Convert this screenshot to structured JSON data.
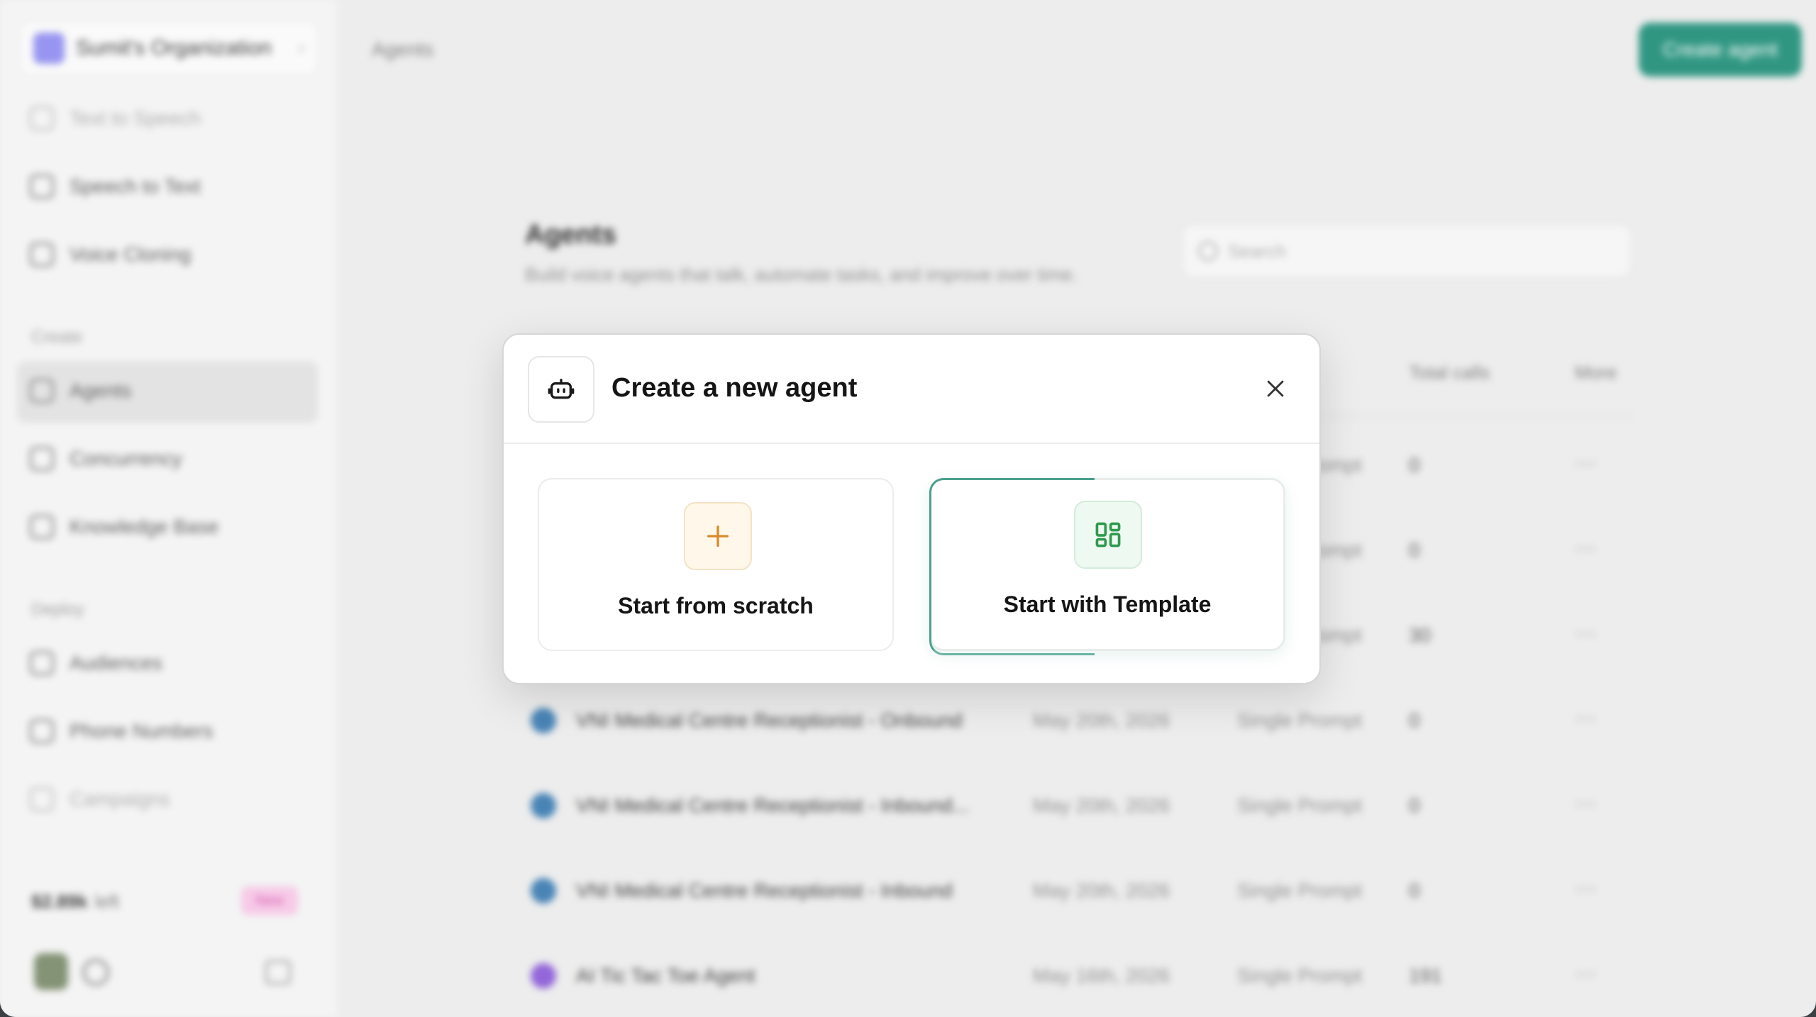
{
  "app": {
    "org_name": "Sumit's Organization",
    "breadcrumb": "Agents",
    "create_agent_label": "Create agent",
    "page_title": "Agents",
    "page_subtitle": "Build voice agents that talk, automate tasks, and improve over time.",
    "search_placeholder": "Search",
    "sidebar": {
      "items_top": [
        {
          "label": "Text to Speech",
          "icon": "text-to-speech-icon"
        },
        {
          "label": "Speech to Text",
          "icon": "speech-to-text-icon"
        },
        {
          "label": "Voice Cloning",
          "icon": "voice-cloning-icon"
        }
      ],
      "section_create": "Create",
      "items_create": [
        {
          "label": "Agents",
          "icon": "agents-icon",
          "active": true
        },
        {
          "label": "Concurrency",
          "icon": "concurrency-icon"
        },
        {
          "label": "Knowledge Base",
          "icon": "knowledge-base-icon"
        }
      ],
      "section_deploy": "Deploy",
      "items_deploy": [
        {
          "label": "Audiences",
          "icon": "audiences-icon"
        },
        {
          "label": "Phone Numbers",
          "icon": "phone-icon"
        },
        {
          "label": "Campaigns",
          "icon": "campaigns-icon"
        }
      ],
      "credits_value": "$2.89k",
      "credits_unit": "left",
      "new_badge": "New"
    },
    "table": {
      "headers": [
        "Total calls",
        "More"
      ],
      "rows": [
        {
          "name": "",
          "date": "",
          "type": "Single Prompt",
          "calls": "0",
          "more": "···"
        },
        {
          "name": "",
          "date": "",
          "type": "Single Prompt",
          "calls": "0",
          "more": "···"
        },
        {
          "name": "",
          "date": "",
          "type": "Single Prompt",
          "calls": "30",
          "more": "···"
        },
        {
          "name": "VNI Medical Centre Receptionist - Onbound",
          "date": "May 20th, 2026",
          "type": "Single Prompt",
          "calls": "0",
          "more": "···"
        },
        {
          "name": "VNI Medical Centre Receptionist - Inbound...",
          "date": "May 20th, 2026",
          "type": "Single Prompt",
          "calls": "0",
          "more": "···"
        },
        {
          "name": "VNI Medical Centre Receptionist - Inbound",
          "date": "May 20th, 2026",
          "type": "Single Prompt",
          "calls": "0",
          "more": "···"
        },
        {
          "name": "AI Tic Tac Toe Agent",
          "date": "May 16th, 2026",
          "type": "Single Prompt",
          "calls": "191",
          "more": "···"
        }
      ]
    }
  },
  "modal": {
    "title": "Create a new agent",
    "icon": "robot-icon",
    "close_icon": "close-icon",
    "options": [
      {
        "label": "Start from scratch",
        "icon": "plus-icon",
        "accent": "#d98a2b"
      },
      {
        "label": "Start with Template",
        "icon": "grid-template-icon",
        "accent": "#2f9a4d"
      }
    ]
  },
  "colors": {
    "brand": "#1f8e78",
    "scratch_accent": "#d98a2b",
    "template_accent": "#2f9a4d"
  }
}
